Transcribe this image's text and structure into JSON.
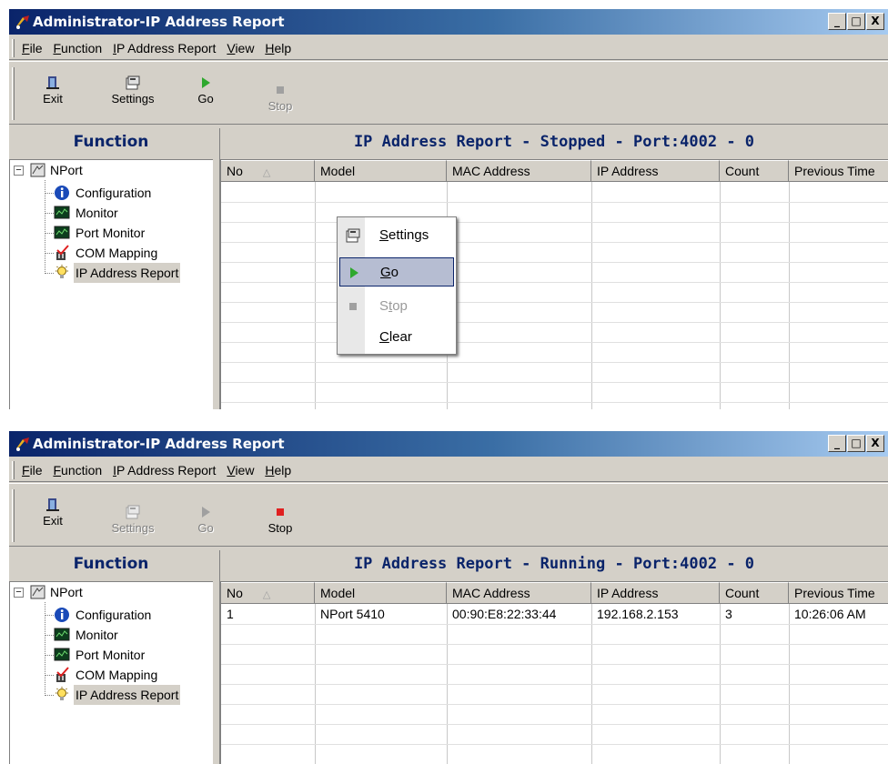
{
  "colors": {
    "title_gradient_start": "#0a246a",
    "title_gradient_end": "#a6caf0",
    "header_text": "#0a246a",
    "go_green": "#2ea82e",
    "stop_red": "#e02020",
    "disabled_gray": "#808080"
  },
  "window_top": {
    "title": "Administrator-IP Address Report",
    "window_buttons": [
      "_",
      "□",
      "X"
    ],
    "menu": [
      {
        "label": "File",
        "underline": "F",
        "rest": "ile"
      },
      {
        "label": "Function",
        "underline": "F",
        "rest": "unction"
      },
      {
        "label": "IP Address Report",
        "underline": "I",
        "rest": "P Address Report"
      },
      {
        "label": "View",
        "underline": "V",
        "rest": "iew"
      },
      {
        "label": "Help",
        "underline": "H",
        "rest": "elp"
      }
    ],
    "toolbar": {
      "exit": "Exit",
      "settings": "Settings",
      "go": "Go",
      "stop": "Stop"
    },
    "function_header": "Function",
    "tree": {
      "root": "NPort",
      "items": [
        "Configuration",
        "Monitor",
        "Port Monitor",
        "COM Mapping",
        "IP Address Report"
      ]
    },
    "report_title": "IP Address Report - Stopped - Port:4002 - 0",
    "columns": [
      "No",
      "Model",
      "MAC Address",
      "IP Address",
      "Count",
      "Previous Time"
    ],
    "sort_icon": "triangle-up",
    "context_menu": [
      {
        "label": "Settings",
        "underline": "S",
        "rest": "ettings",
        "icon": "settings-icon",
        "state": "normal"
      },
      {
        "label": "Go",
        "underline": "G",
        "rest": "o",
        "icon": "go-icon",
        "state": "highlighted"
      },
      {
        "label": "Stop",
        "underline": "t",
        "rest_before": "S",
        "rest": "op",
        "icon": "stop-icon",
        "state": "disabled"
      },
      {
        "label": "Clear",
        "underline": "C",
        "rest": "lear",
        "icon": "",
        "state": "normal"
      }
    ]
  },
  "window_bottom": {
    "title": "Administrator-IP Address Report",
    "window_buttons": [
      "_",
      "□",
      "X"
    ],
    "menu": [
      {
        "label": "File",
        "underline": "F",
        "rest": "ile"
      },
      {
        "label": "Function",
        "underline": "F",
        "rest": "unction"
      },
      {
        "label": "IP Address Report",
        "underline": "I",
        "rest": "P Address Report"
      },
      {
        "label": "View",
        "underline": "V",
        "rest": "iew"
      },
      {
        "label": "Help",
        "underline": "H",
        "rest": "elp"
      }
    ],
    "toolbar": {
      "exit": "Exit",
      "settings": "Settings",
      "go": "Go",
      "stop": "Stop"
    },
    "function_header": "Function",
    "tree": {
      "root": "NPort",
      "items": [
        "Configuration",
        "Monitor",
        "Port Monitor",
        "COM Mapping",
        "IP Address Report"
      ]
    },
    "report_title": "IP Address Report - Running - Port:4002 - 0",
    "columns": [
      "No",
      "Model",
      "MAC Address",
      "IP Address",
      "Count",
      "Previous Time"
    ],
    "rows": [
      {
        "no": "1",
        "model": "NPort 5410",
        "mac": "00:90:E8:22:33:44",
        "ip": "192.168.2.153",
        "count": "3",
        "time": "10:26:06 AM"
      }
    ]
  }
}
